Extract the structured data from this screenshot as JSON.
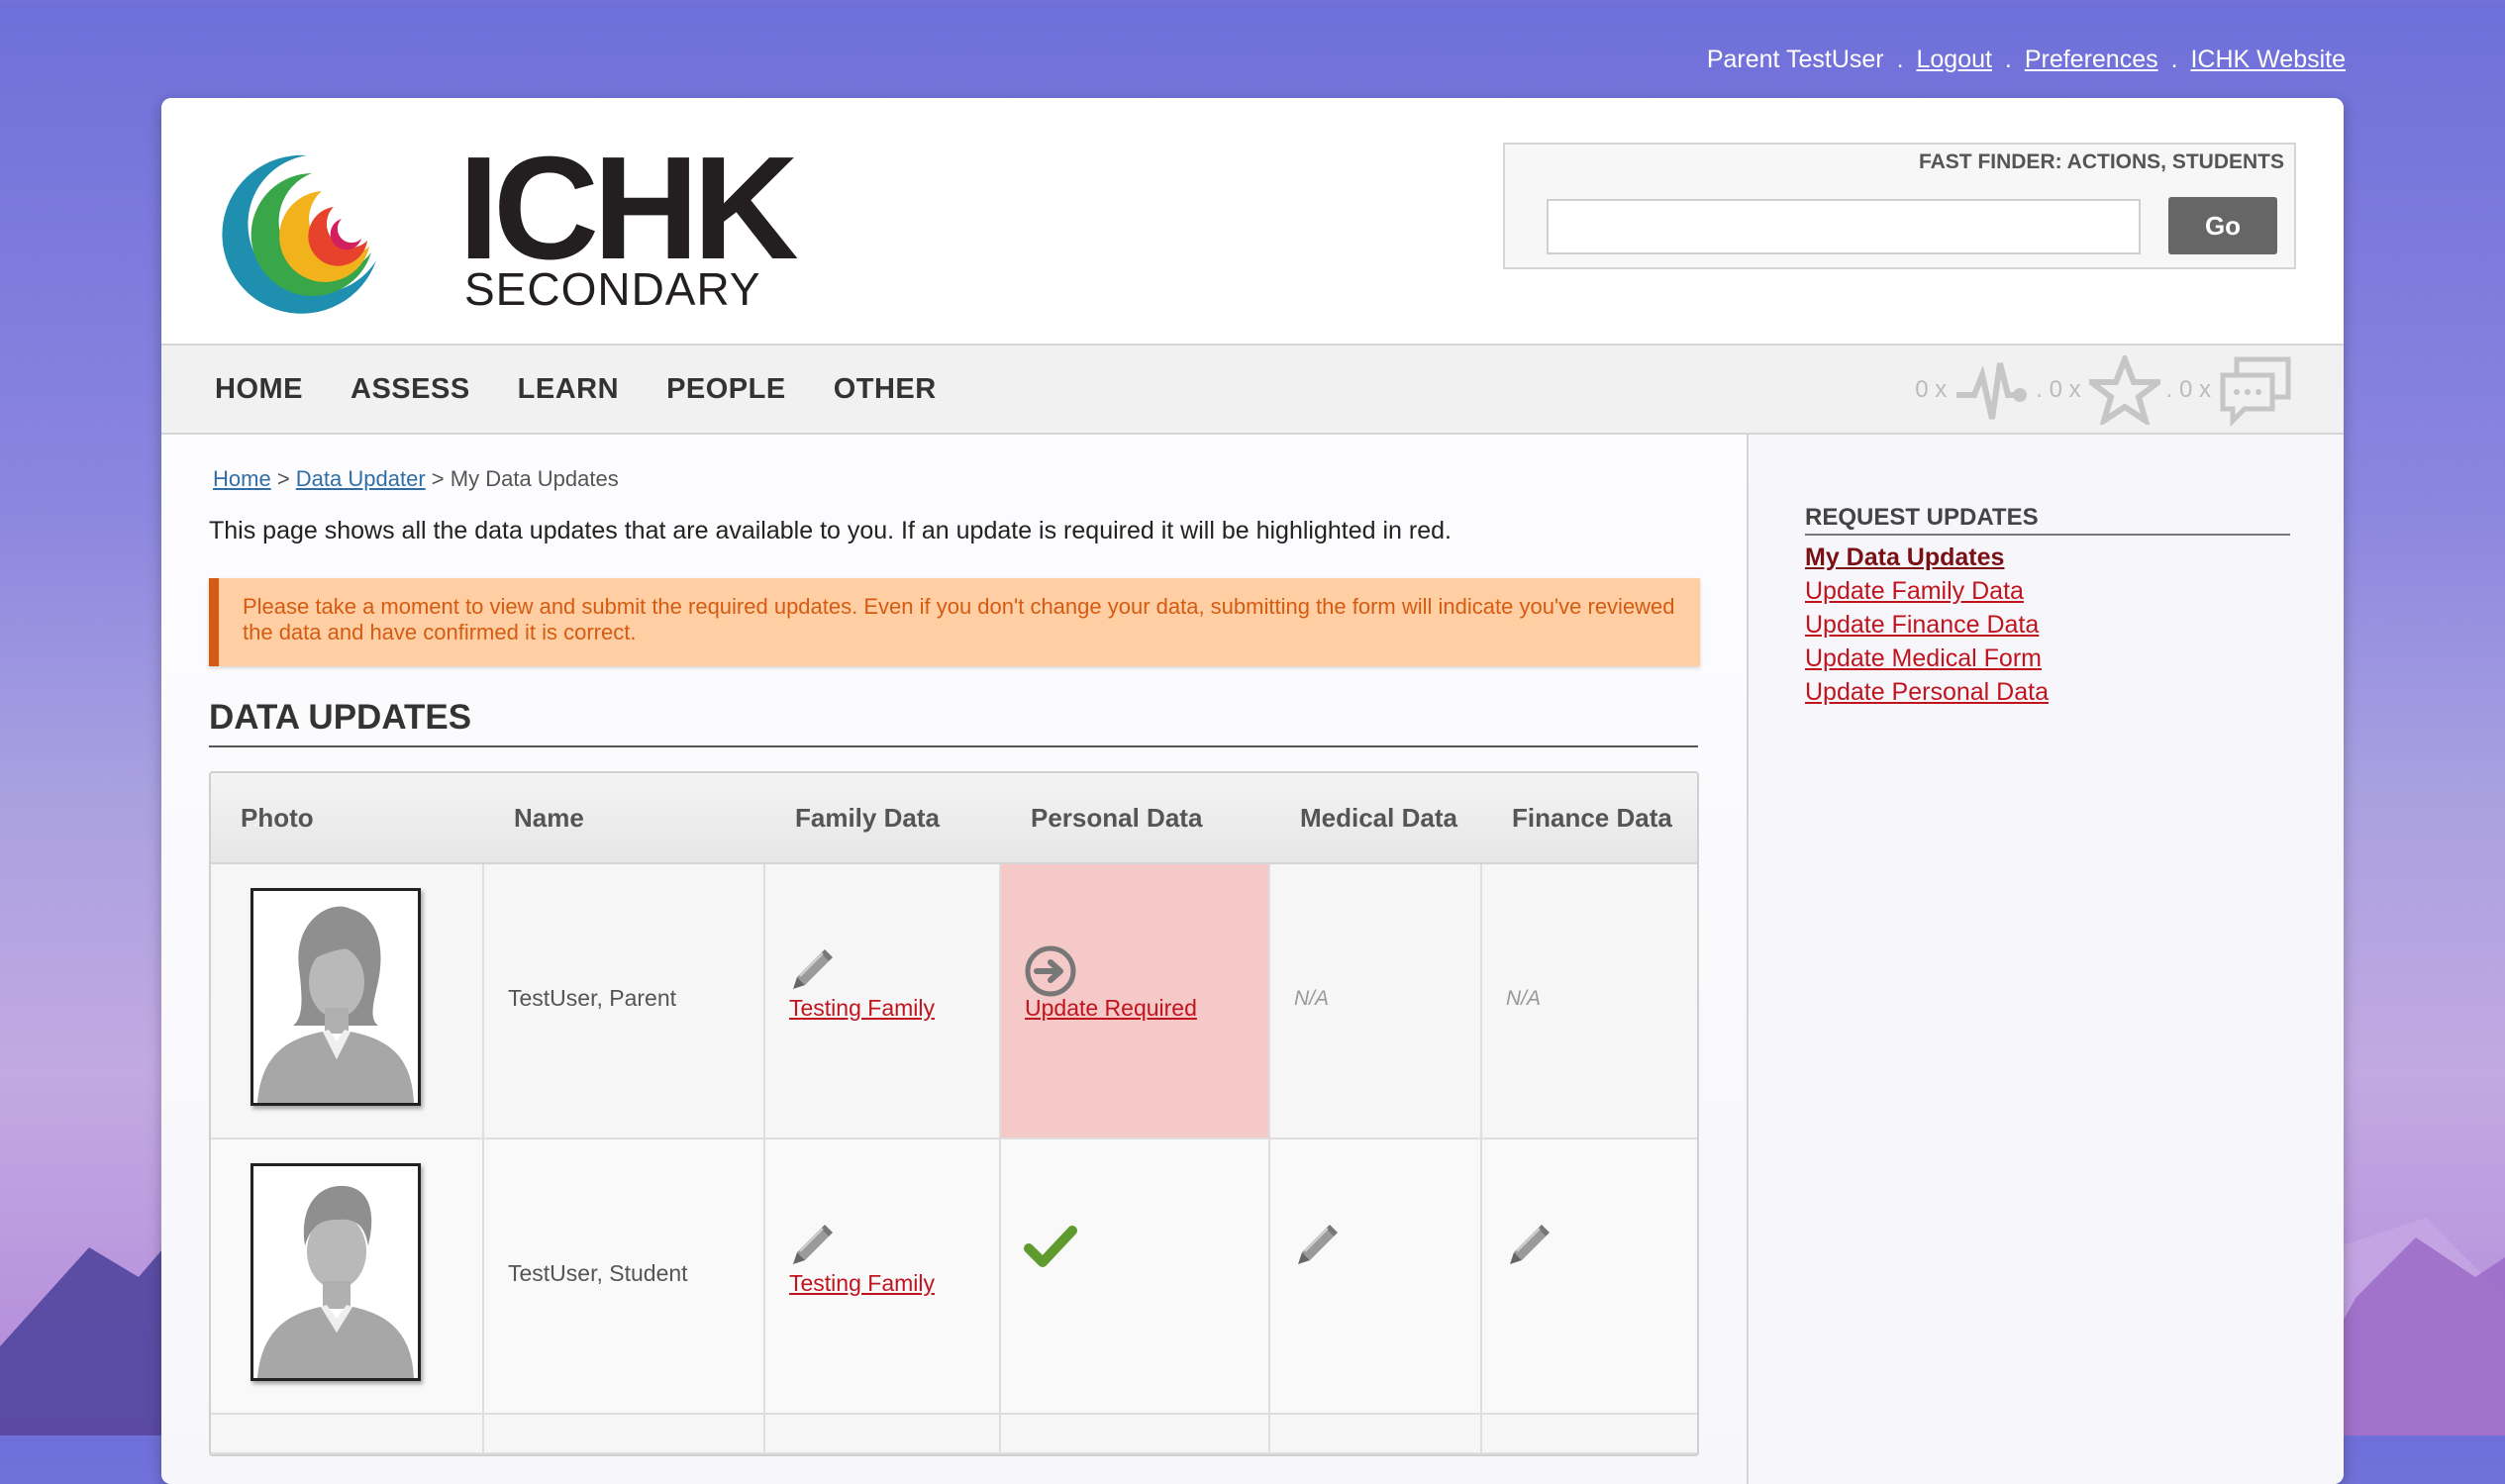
{
  "top_links": {
    "user": "Parent TestUser",
    "logout": "Logout",
    "preferences": "Preferences",
    "website": "ICHK Website",
    "separator": "."
  },
  "logo": {
    "main": "ICHK",
    "sub": "SECONDARY"
  },
  "fast_finder": {
    "title": "FAST FINDER: ACTIONS, STUDENTS",
    "value": "",
    "go_label": "Go"
  },
  "nav": {
    "items": [
      "HOME",
      "ASSESS",
      "LEARN",
      "PEOPLE",
      "OTHER"
    ]
  },
  "counters": [
    {
      "label": "0 x",
      "icon": "activity-pulse-icon"
    },
    {
      "label": ". 0 x",
      "icon": "star-icon"
    },
    {
      "label": ". 0 x",
      "icon": "messages-icon"
    }
  ],
  "breadcrumb": {
    "home": "Home",
    "sep": ">",
    "data_updater": "Data Updater",
    "current": "My Data Updates"
  },
  "intro": "This page shows all the data updates that are available to you. If an update is required it will be highlighted in red.",
  "alert": "Please take a moment to view and submit the required updates. Even if you don't change your data, submitting the form will indicate you've reviewed the data and have confirmed it is correct.",
  "section_title": "DATA UPDATES",
  "table": {
    "headers": [
      "Photo",
      "Name",
      "Family Data",
      "Personal Data",
      "Medical Data",
      "Finance Data"
    ],
    "rows": [
      {
        "name": "TestUser, Parent",
        "family": "Testing Family",
        "personal": "Update Required",
        "medical": "N/A",
        "finance": "N/A"
      },
      {
        "name": "TestUser, Student",
        "family": "Testing Family"
      }
    ]
  },
  "sidebar": {
    "title": "REQUEST UPDATES",
    "links": [
      "My Data Updates",
      "Update Family Data",
      "Update Finance Data",
      "Update Medical Form",
      "Update Personal Data"
    ]
  },
  "colors": {
    "accent_red": "#c0141e",
    "alert_bg": "#ffcfa3",
    "alert_text": "#d65b12",
    "required_bg": "#f5c9c8"
  }
}
